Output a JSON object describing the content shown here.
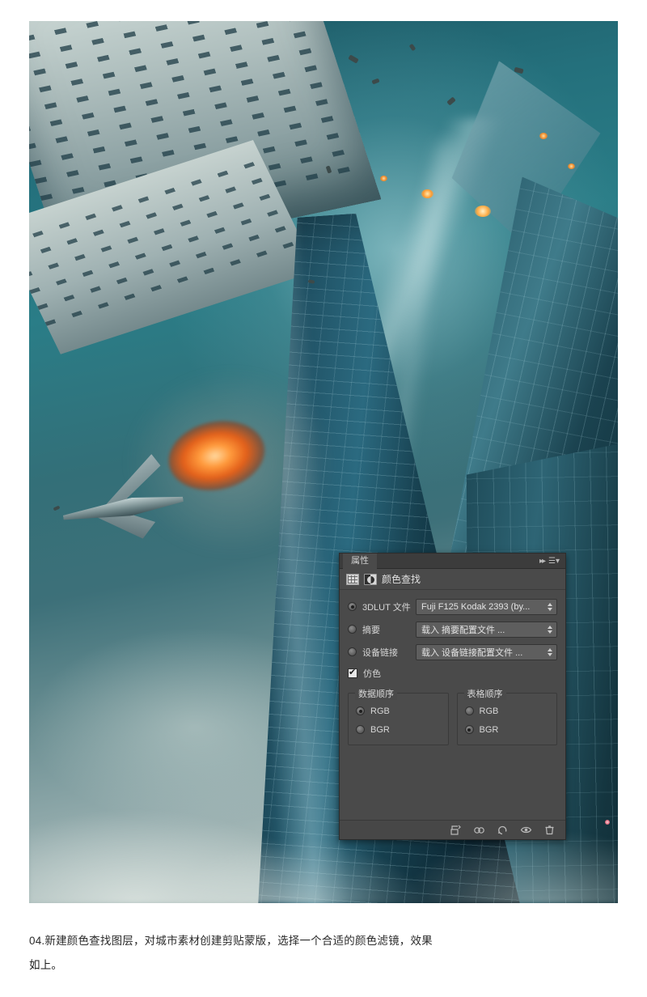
{
  "panel": {
    "tab_label": "属性",
    "collapse_icon": "double-chevron-right-icon",
    "menu_icon": "panel-menu-icon",
    "header_title": "颜色查找",
    "adjustment_icon": "adjustment-grid-icon",
    "clip_icon": "clip-to-layer-icon",
    "rows": [
      {
        "id": "lut3d",
        "label": "3DLUT 文件",
        "selected": true,
        "value": "Fuji F125 Kodak 2393 (by..."
      },
      {
        "id": "abstract",
        "label": "摘要",
        "selected": false,
        "value": "载入 摘要配置文件 ..."
      },
      {
        "id": "devicelink",
        "label": "设备链接",
        "selected": false,
        "value": "载入 设备链接配置文件 ..."
      }
    ],
    "dither": {
      "label": "仿色",
      "checked": true
    },
    "groups": [
      {
        "legend": "数据顺序",
        "options": [
          {
            "label": "RGB",
            "selected": true
          },
          {
            "label": "BGR",
            "selected": false
          }
        ]
      },
      {
        "legend": "表格顺序",
        "options": [
          {
            "label": "RGB",
            "selected": false
          },
          {
            "label": "BGR",
            "selected": true
          }
        ]
      }
    ],
    "footer_icons": [
      "clip-to-layer-icon",
      "view-previous-state-icon",
      "reset-icon",
      "toggle-visibility-icon",
      "delete-layer-icon"
    ]
  },
  "caption": {
    "line1": "04.新建颜色查找图层，对城市素材创建剪贴蒙版，选择一个合适的颜色滤镜，效果",
    "line2": "如上。"
  },
  "colors": {
    "panel_bg": "#4a4a4a",
    "panel_header": "#3c3c3c",
    "select_bg": "#5e5e5e",
    "text": "#d4d4d4",
    "accent_orange": "#e3601a"
  }
}
